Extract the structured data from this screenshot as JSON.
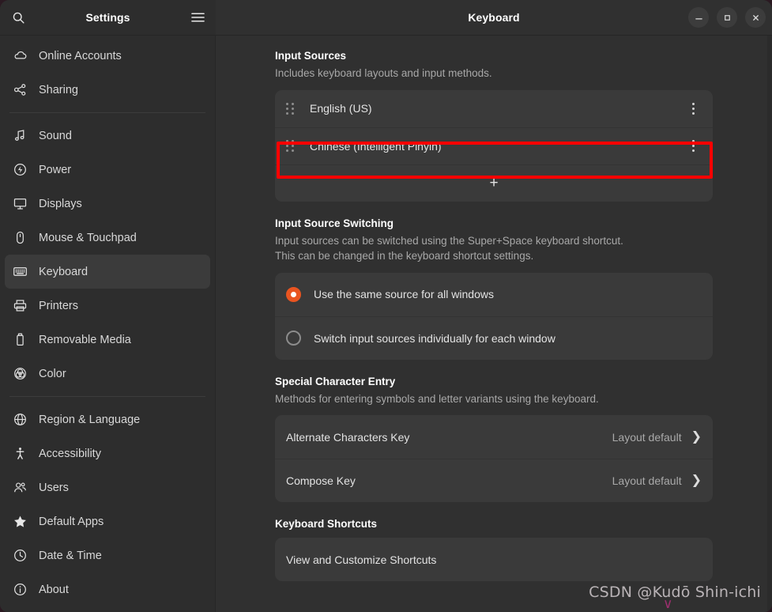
{
  "window": {
    "title": "Keyboard",
    "controls": {
      "minimize": "–",
      "maximize": "□",
      "close": "✕"
    }
  },
  "sidebar": {
    "title": "Settings",
    "search_icon": "search-icon",
    "menu_icon": "hamburger-menu-icon",
    "items": [
      {
        "label": "Online Accounts",
        "icon": "cloud-icon",
        "selected": false
      },
      {
        "label": "Sharing",
        "icon": "share-nodes-icon",
        "selected": false
      },
      {
        "separator": true
      },
      {
        "label": "Sound",
        "icon": "music-note-icon",
        "selected": false
      },
      {
        "label": "Power",
        "icon": "power-bolt-icon",
        "selected": false
      },
      {
        "label": "Displays",
        "icon": "monitor-icon",
        "selected": false
      },
      {
        "label": "Mouse & Touchpad",
        "icon": "mouse-icon",
        "selected": false
      },
      {
        "label": "Keyboard",
        "icon": "keyboard-icon",
        "selected": true
      },
      {
        "label": "Printers",
        "icon": "printer-icon",
        "selected": false
      },
      {
        "label": "Removable Media",
        "icon": "usb-drive-icon",
        "selected": false
      },
      {
        "label": "Color",
        "icon": "color-wheel-icon",
        "selected": false
      },
      {
        "separator": true
      },
      {
        "label": "Region & Language",
        "icon": "globe-icon",
        "selected": false
      },
      {
        "label": "Accessibility",
        "icon": "accessibility-icon",
        "selected": false
      },
      {
        "label": "Users",
        "icon": "users-icon",
        "selected": false
      },
      {
        "label": "Default Apps",
        "icon": "star-icon",
        "selected": false
      },
      {
        "label": "Date & Time",
        "icon": "clock-icon",
        "selected": false
      },
      {
        "label": "About",
        "icon": "info-circle-icon",
        "selected": false
      }
    ]
  },
  "main": {
    "input_sources": {
      "title": "Input Sources",
      "subtitle": "Includes keyboard layouts and input methods.",
      "rows": [
        {
          "label": "English (US)",
          "highlighted": false
        },
        {
          "label": "Chinese (Intelligent Pinyin)",
          "highlighted": true
        }
      ],
      "add_label": "+"
    },
    "input_source_switching": {
      "title": "Input Source Switching",
      "subtitle_line1": "Input sources can be switched using the Super+Space keyboard shortcut.",
      "subtitle_line2": "This can be changed in the keyboard shortcut settings.",
      "options": [
        {
          "label": "Use the same source for all windows",
          "selected": true
        },
        {
          "label": "Switch input sources individually for each window",
          "selected": false
        }
      ]
    },
    "special_character_entry": {
      "title": "Special Character Entry",
      "subtitle": "Methods for entering symbols and letter variants using the keyboard.",
      "rows": [
        {
          "label": "Alternate Characters Key",
          "value": "Layout default",
          "chevron": "❯"
        },
        {
          "label": "Compose Key",
          "value": "Layout default",
          "chevron": "❯"
        }
      ]
    },
    "keyboard_shortcuts": {
      "title": "Keyboard Shortcuts",
      "rows": [
        {
          "label": "View and Customize Shortcuts"
        }
      ]
    }
  },
  "watermark": {
    "text": "CSDN @Kudō Shin-ichi",
    "caret": "∨"
  },
  "colors": {
    "accent": "#e95420",
    "highlight_box": "#fd0000",
    "window_bg": "#303030",
    "sidebar_bg": "#2d2d2d",
    "card_bg": "#3a3a3a",
    "desktop_bg": "#2b1a22"
  }
}
